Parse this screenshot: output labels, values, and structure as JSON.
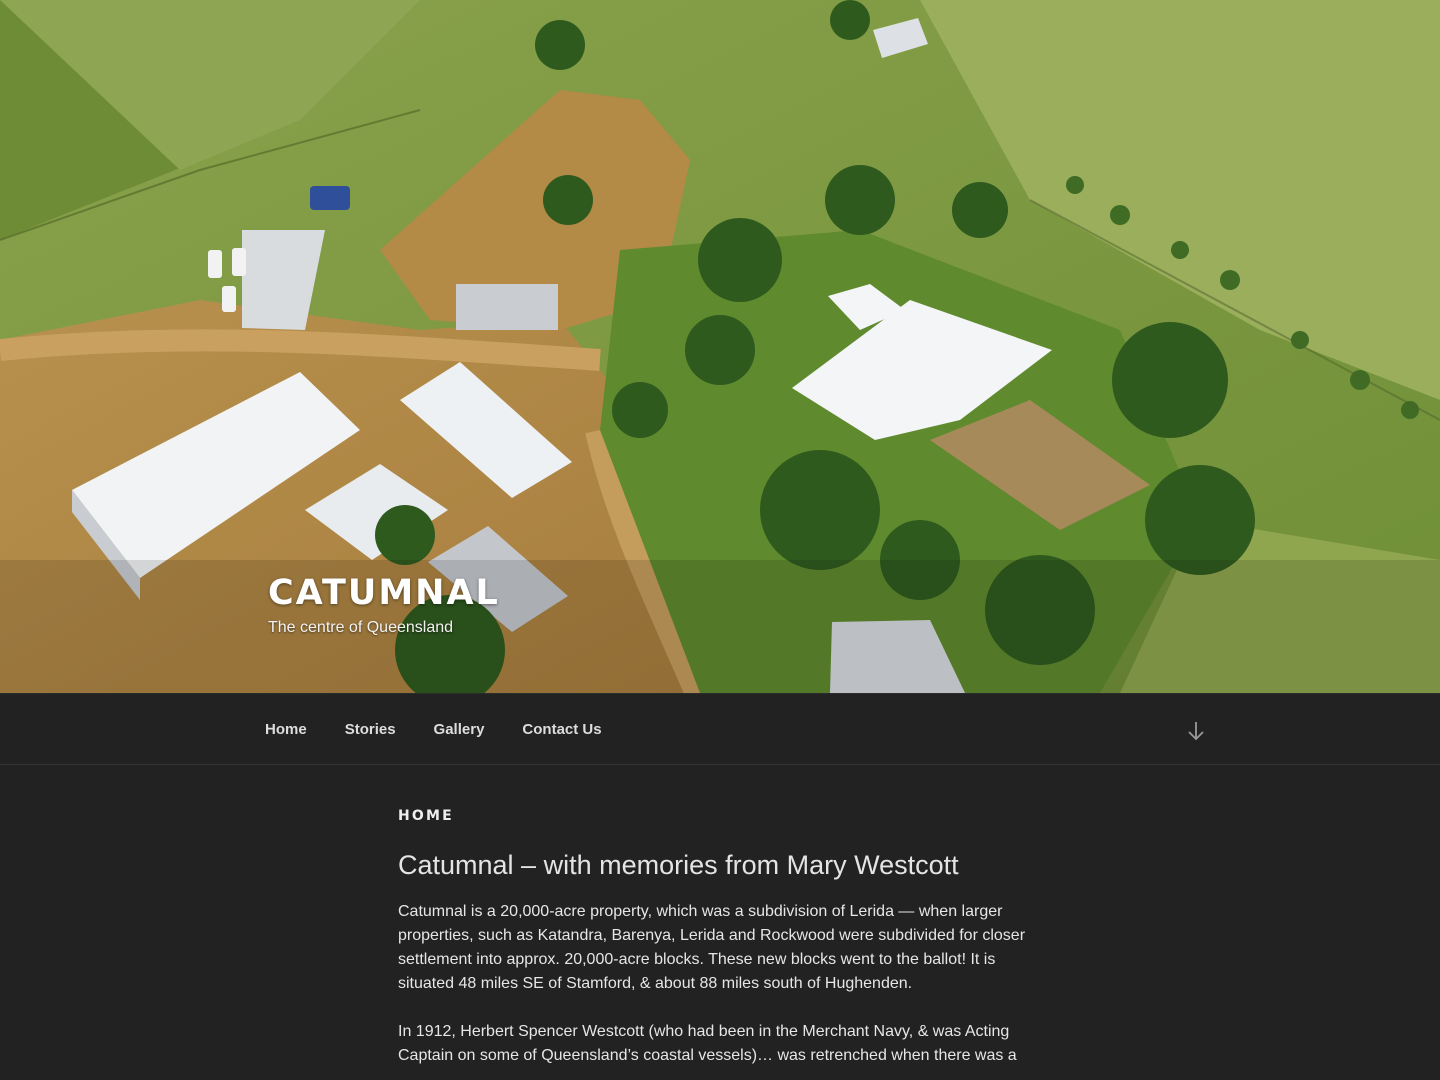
{
  "site": {
    "title": "CATUMNAL",
    "description": "The centre of Queensland"
  },
  "nav": {
    "items": [
      {
        "label": "Home"
      },
      {
        "label": "Stories"
      },
      {
        "label": "Gallery"
      },
      {
        "label": "Contact Us"
      }
    ],
    "scroll_icon": "arrow-down-icon"
  },
  "page": {
    "breadcrumb": "HOME",
    "title": "Catumnal – with memories from Mary Westcott",
    "paragraphs": [
      "Catumnal is a 20,000-acre property, which was a subdivision of Lerida — when larger properties, such as Katandra, Barenya, Lerida and Rockwood were subdivided for closer settlement into approx. 20,000-acre blocks. These new blocks went to the ballot! It is situated 48 miles SE of Stamford, & about 88 miles south of Hughenden.",
      "In 1912, Herbert Spencer Westcott (who had been in the Merchant Navy, & was Acting Captain on some of Queensland’s coastal vessels)… was retrenched when there was a"
    ]
  },
  "colors": {
    "background": "#222222",
    "text": "#dddddd",
    "grass": "#7b9a45",
    "dirt": "#c59a55",
    "roof": "#eef0f2"
  }
}
